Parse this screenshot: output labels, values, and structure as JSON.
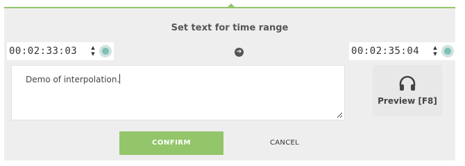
{
  "dialog": {
    "title": "Set text for time range",
    "start_time": "00:02:33:03",
    "end_time": "00:02:35:04",
    "text_value": "Demo of interpolation.",
    "preview_label": "Preview [F8]",
    "confirm_label": "CONFIRM",
    "cancel_label": "CANCEL"
  },
  "icons": {
    "spin_up": "▲",
    "spin_down": "▼",
    "arrow": "➔",
    "preview": "headphones-icon",
    "keyframe_marker": "circle-dot-icon"
  },
  "colors": {
    "accent": "#93c56a",
    "marker": "#7fbfb5",
    "dialog_bg": "#eeeeee"
  }
}
